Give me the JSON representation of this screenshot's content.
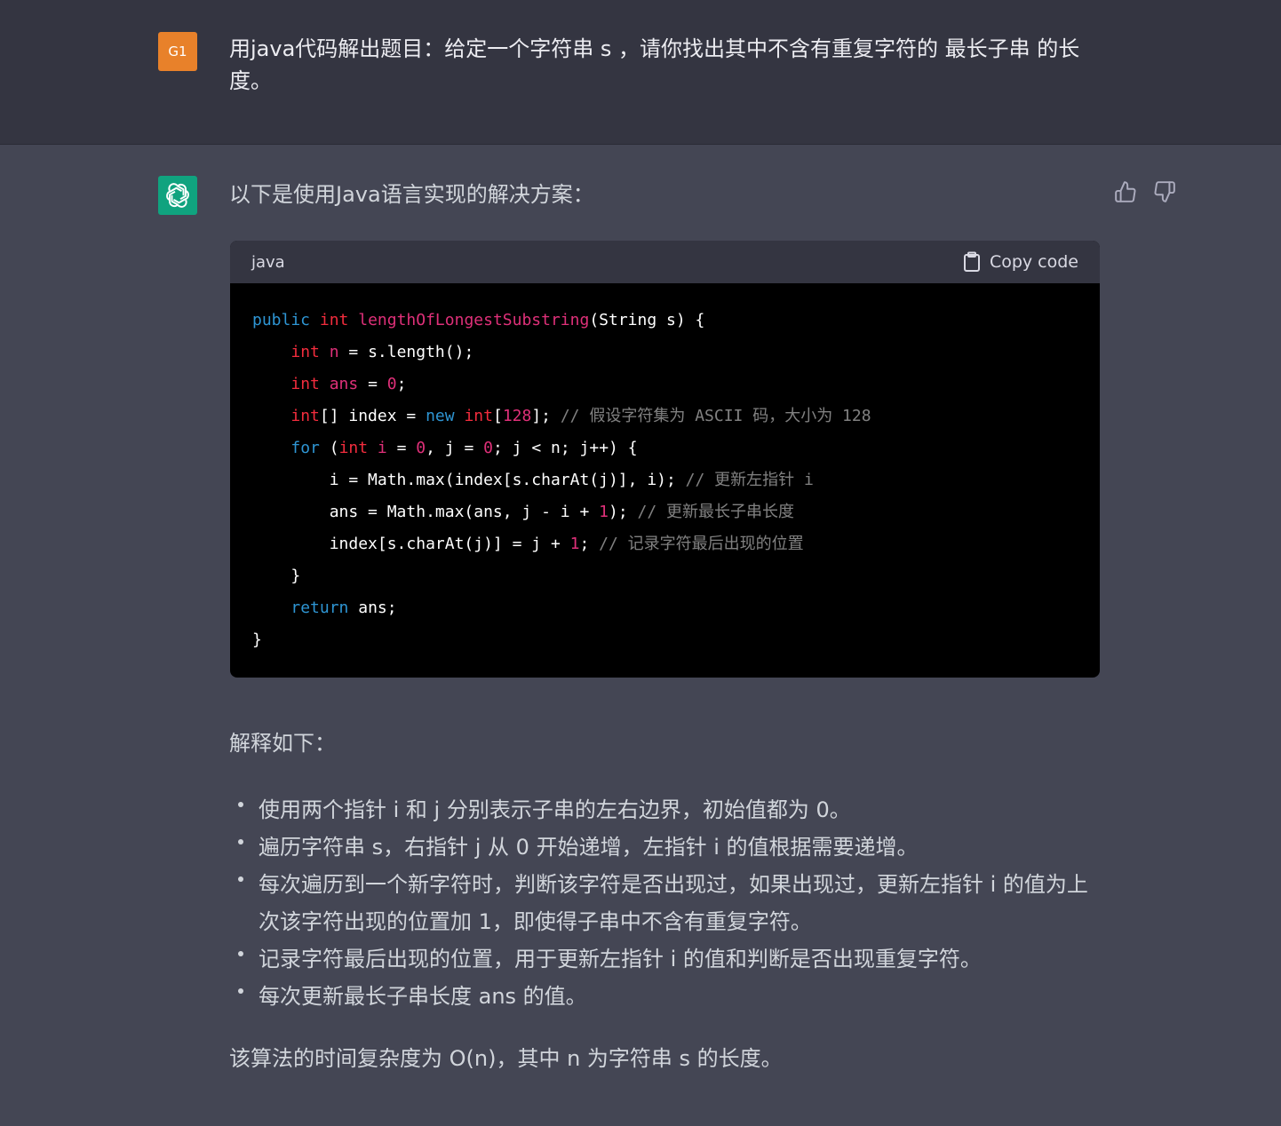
{
  "user": {
    "avatar_label": "G1",
    "avatar_color": "#e8812a",
    "message": "用java代码解出题目：给定一个字符串 s ，请你找出其中不含有重复字符的 最长子串 的长度。"
  },
  "assistant": {
    "avatar_icon": "openai-logo-icon",
    "avatar_color": "#10a37f",
    "intro": "以下是使用Java语言实现的解决方案：",
    "feedback": {
      "thumbs_up_icon": "thumbs-up-icon",
      "thumbs_down_icon": "thumbs-down-icon"
    },
    "code": {
      "language": "java",
      "copy_label": "Copy code",
      "copy_icon": "clipboard-icon",
      "lines": [
        "public int lengthOfLongestSubstring(String s) {",
        "    int n = s.length();",
        "    int ans = 0;",
        "    int[] index = new int[128]; // 假设字符集为 ASCII 码，大小为 128",
        "    for (int i = 0, j = 0; j < n; j++) {",
        "        i = Math.max(index[s.charAt(j)], i); // 更新左指针 i",
        "        ans = Math.max(ans, j - i + 1); // 更新最长子串长度",
        "        index[s.charAt(j)] = j + 1; // 记录字符最后出现的位置",
        "    }",
        "    return ans;",
        "}"
      ]
    },
    "explain_title": "解释如下：",
    "bullets": [
      "使用两个指针 i 和 j 分别表示子串的左右边界，初始值都为 0。",
      "遍历字符串 s，右指针 j 从 0 开始递增，左指针 i 的值根据需要递增。",
      "每次遍历到一个新字符时，判断该字符是否出现过，如果出现过，更新左指针 i 的值为上次该字符出现的位置加 1，即使得子串中不含有重复字符。",
      "记录字符最后出现的位置，用于更新左指针 i 的值和判断是否出现重复字符。",
      "每次更新最长子串长度 ans 的值。"
    ],
    "summary": "该算法的时间复杂度为 O(n)，其中 n 为字符串 s 的长度。"
  }
}
